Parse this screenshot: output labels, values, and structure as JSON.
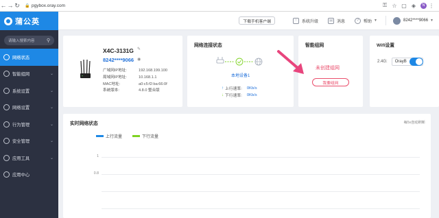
{
  "browser": {
    "url": "pgybox.oray.com"
  },
  "sidebar": {
    "brand": "蒲公英",
    "search_placeholder": "请输入搜索内容",
    "items": [
      {
        "label": "网络状态",
        "active": true
      },
      {
        "label": "智能组网",
        "active": false
      },
      {
        "label": "系统设置",
        "active": false
      },
      {
        "label": "网络设置",
        "active": false
      },
      {
        "label": "行为管理",
        "active": false
      },
      {
        "label": "安全管理",
        "active": false
      },
      {
        "label": "应用工具",
        "active": false
      },
      {
        "label": "应用中心",
        "active": false
      }
    ]
  },
  "topbar": {
    "download": "下载手机客户端",
    "upgrade": "系统升级",
    "messages": "消息",
    "help": "帮助",
    "user": "8242****9066"
  },
  "device": {
    "name": "X4C-3131G",
    "id": "8242****9066",
    "info": [
      {
        "k": "广域网IP地址:",
        "v": "192.168.199.100"
      },
      {
        "k": "局域网IP地址:",
        "v": "10.168.1.1"
      },
      {
        "k": "MAC地址:",
        "v": "a0:c5:f2:ba:66:0f"
      },
      {
        "k": "系统版本:",
        "v": "4.8.0 整合版"
      }
    ]
  },
  "network": {
    "title": "网络连接状态",
    "local": "本地设备1",
    "up_label": "上行速率:",
    "up_value": "0Kb/s",
    "down_label": "下行速率:",
    "down_value": "0Kb/s"
  },
  "smart": {
    "title": "智能组网",
    "empty": "未创建组网",
    "button": "我要组网"
  },
  "wifi": {
    "title": "Wifi设置",
    "band": "2.4G:",
    "ssid": "OrayB",
    "enabled": true
  },
  "realtime": {
    "title": "实时网络状态",
    "note": "每5s自动刷新",
    "legend": [
      {
        "name": "上行流量",
        "color": "#1e88e5"
      },
      {
        "name": "下行流量",
        "color": "#7ed321"
      }
    ],
    "yticks": [
      "1",
      "0.8"
    ]
  },
  "colors": {
    "accent": "#1e88e5",
    "sidebar": "#2c3141",
    "alert": "#ea4e6c"
  }
}
